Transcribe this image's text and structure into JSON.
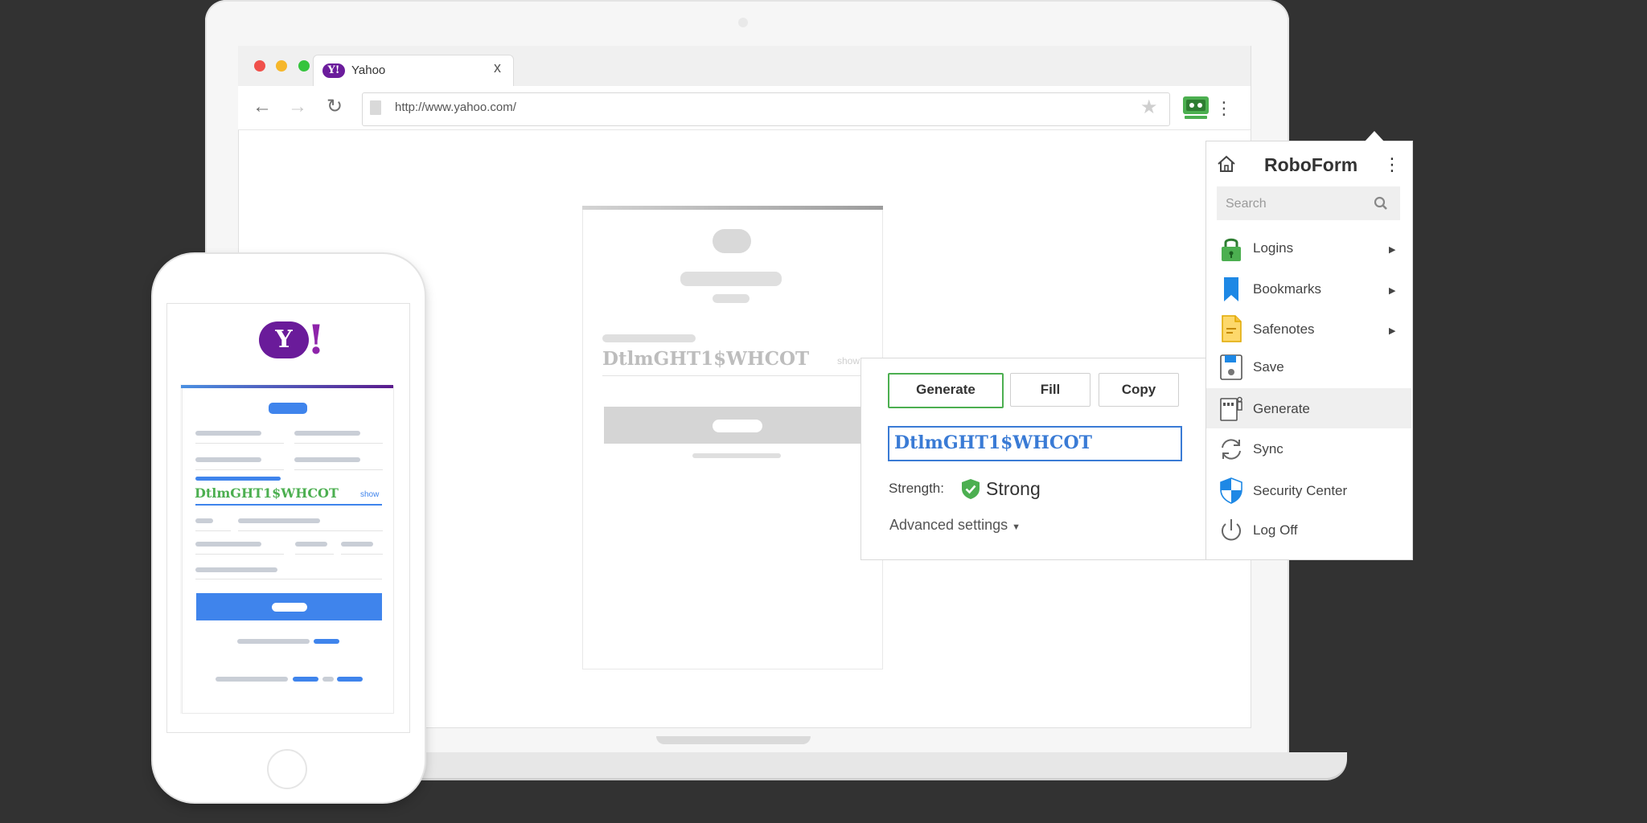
{
  "browser": {
    "tab_title": "Yahoo",
    "tab_close": "x",
    "url": "http://www.yahoo.com/",
    "favicon_text": "Y!"
  },
  "page": {
    "ghost_password": "DtlmGHT1$WHCOT",
    "ghost_show": "show"
  },
  "generator": {
    "buttons": {
      "generate": "Generate",
      "fill": "Fill",
      "copy": "Copy"
    },
    "password": "DtlmGHT1$WHCOT",
    "strength_label": "Strength:",
    "strength_value": "Strong",
    "advanced": "Advanced settings"
  },
  "roboform": {
    "title": "RoboForm",
    "search_placeholder": "Search",
    "items": [
      {
        "label": "Logins",
        "icon": "lock-icon",
        "submenu": true
      },
      {
        "label": "Bookmarks",
        "icon": "bookmark-icon",
        "submenu": true
      },
      {
        "label": "Safenotes",
        "icon": "note-icon",
        "submenu": true
      },
      {
        "label": "Save",
        "icon": "save-icon",
        "submenu": false
      },
      {
        "label": "Generate",
        "icon": "generate-icon",
        "submenu": false,
        "highlighted": true
      },
      {
        "label": "Sync",
        "icon": "sync-icon",
        "submenu": false
      },
      {
        "label": "Security Center",
        "icon": "shield-icon",
        "submenu": false
      },
      {
        "label": "Log Off",
        "icon": "power-icon",
        "submenu": false
      }
    ]
  },
  "phone": {
    "logo": "Y",
    "logo_bang": "!",
    "password": "DtlmGHT1$WHCOT",
    "show": "show"
  },
  "colors": {
    "background": "#323232",
    "accent_blue": "#3a7bd5",
    "accent_green": "#4caf50",
    "yahoo_purple": "#6a1b9a"
  }
}
